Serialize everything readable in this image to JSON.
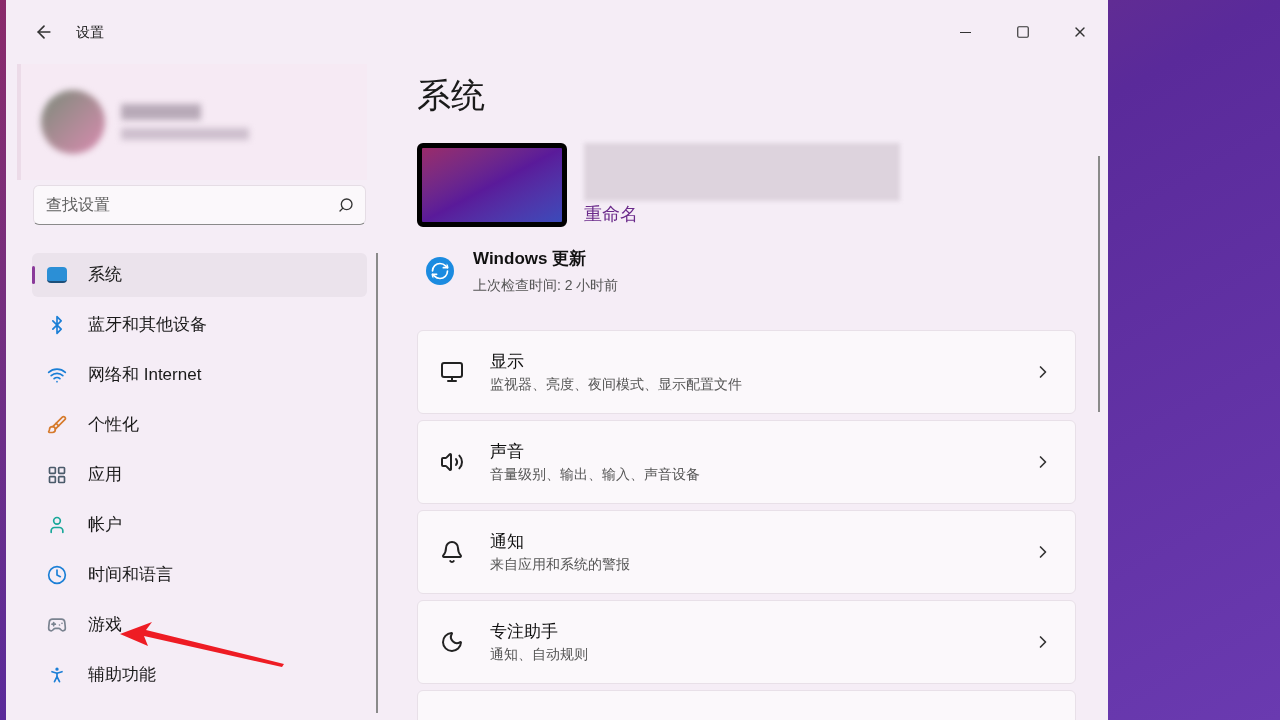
{
  "window": {
    "title": "设置"
  },
  "search": {
    "placeholder": "查找设置"
  },
  "sidebar": {
    "items": [
      {
        "label": "系统",
        "kind": "system",
        "selected": true
      },
      {
        "label": "蓝牙和其他设备",
        "kind": "bluetooth",
        "selected": false
      },
      {
        "label": "网络和 Internet",
        "kind": "wifi",
        "selected": false
      },
      {
        "label": "个性化",
        "kind": "brush",
        "selected": false
      },
      {
        "label": "应用",
        "kind": "apps",
        "selected": false
      },
      {
        "label": "帐户",
        "kind": "account",
        "selected": false
      },
      {
        "label": "时间和语言",
        "kind": "clock",
        "selected": false
      },
      {
        "label": "游戏",
        "kind": "gamepad",
        "selected": false
      },
      {
        "label": "辅助功能",
        "kind": "access",
        "selected": false
      }
    ]
  },
  "page": {
    "title": "系统",
    "rename_link": "重命名",
    "update": {
      "title": "Windows 更新",
      "subtitle": "上次检查时间: 2 小时前"
    },
    "cards": [
      {
        "title": "显示",
        "subtitle": "监视器、亮度、夜间模式、显示配置文件",
        "kind": "display"
      },
      {
        "title": "声音",
        "subtitle": "音量级别、输出、输入、声音设备",
        "kind": "sound"
      },
      {
        "title": "通知",
        "subtitle": "来自应用和系统的警报",
        "kind": "bell"
      },
      {
        "title": "专注助手",
        "subtitle": "通知、自动规则",
        "kind": "moon"
      }
    ]
  }
}
